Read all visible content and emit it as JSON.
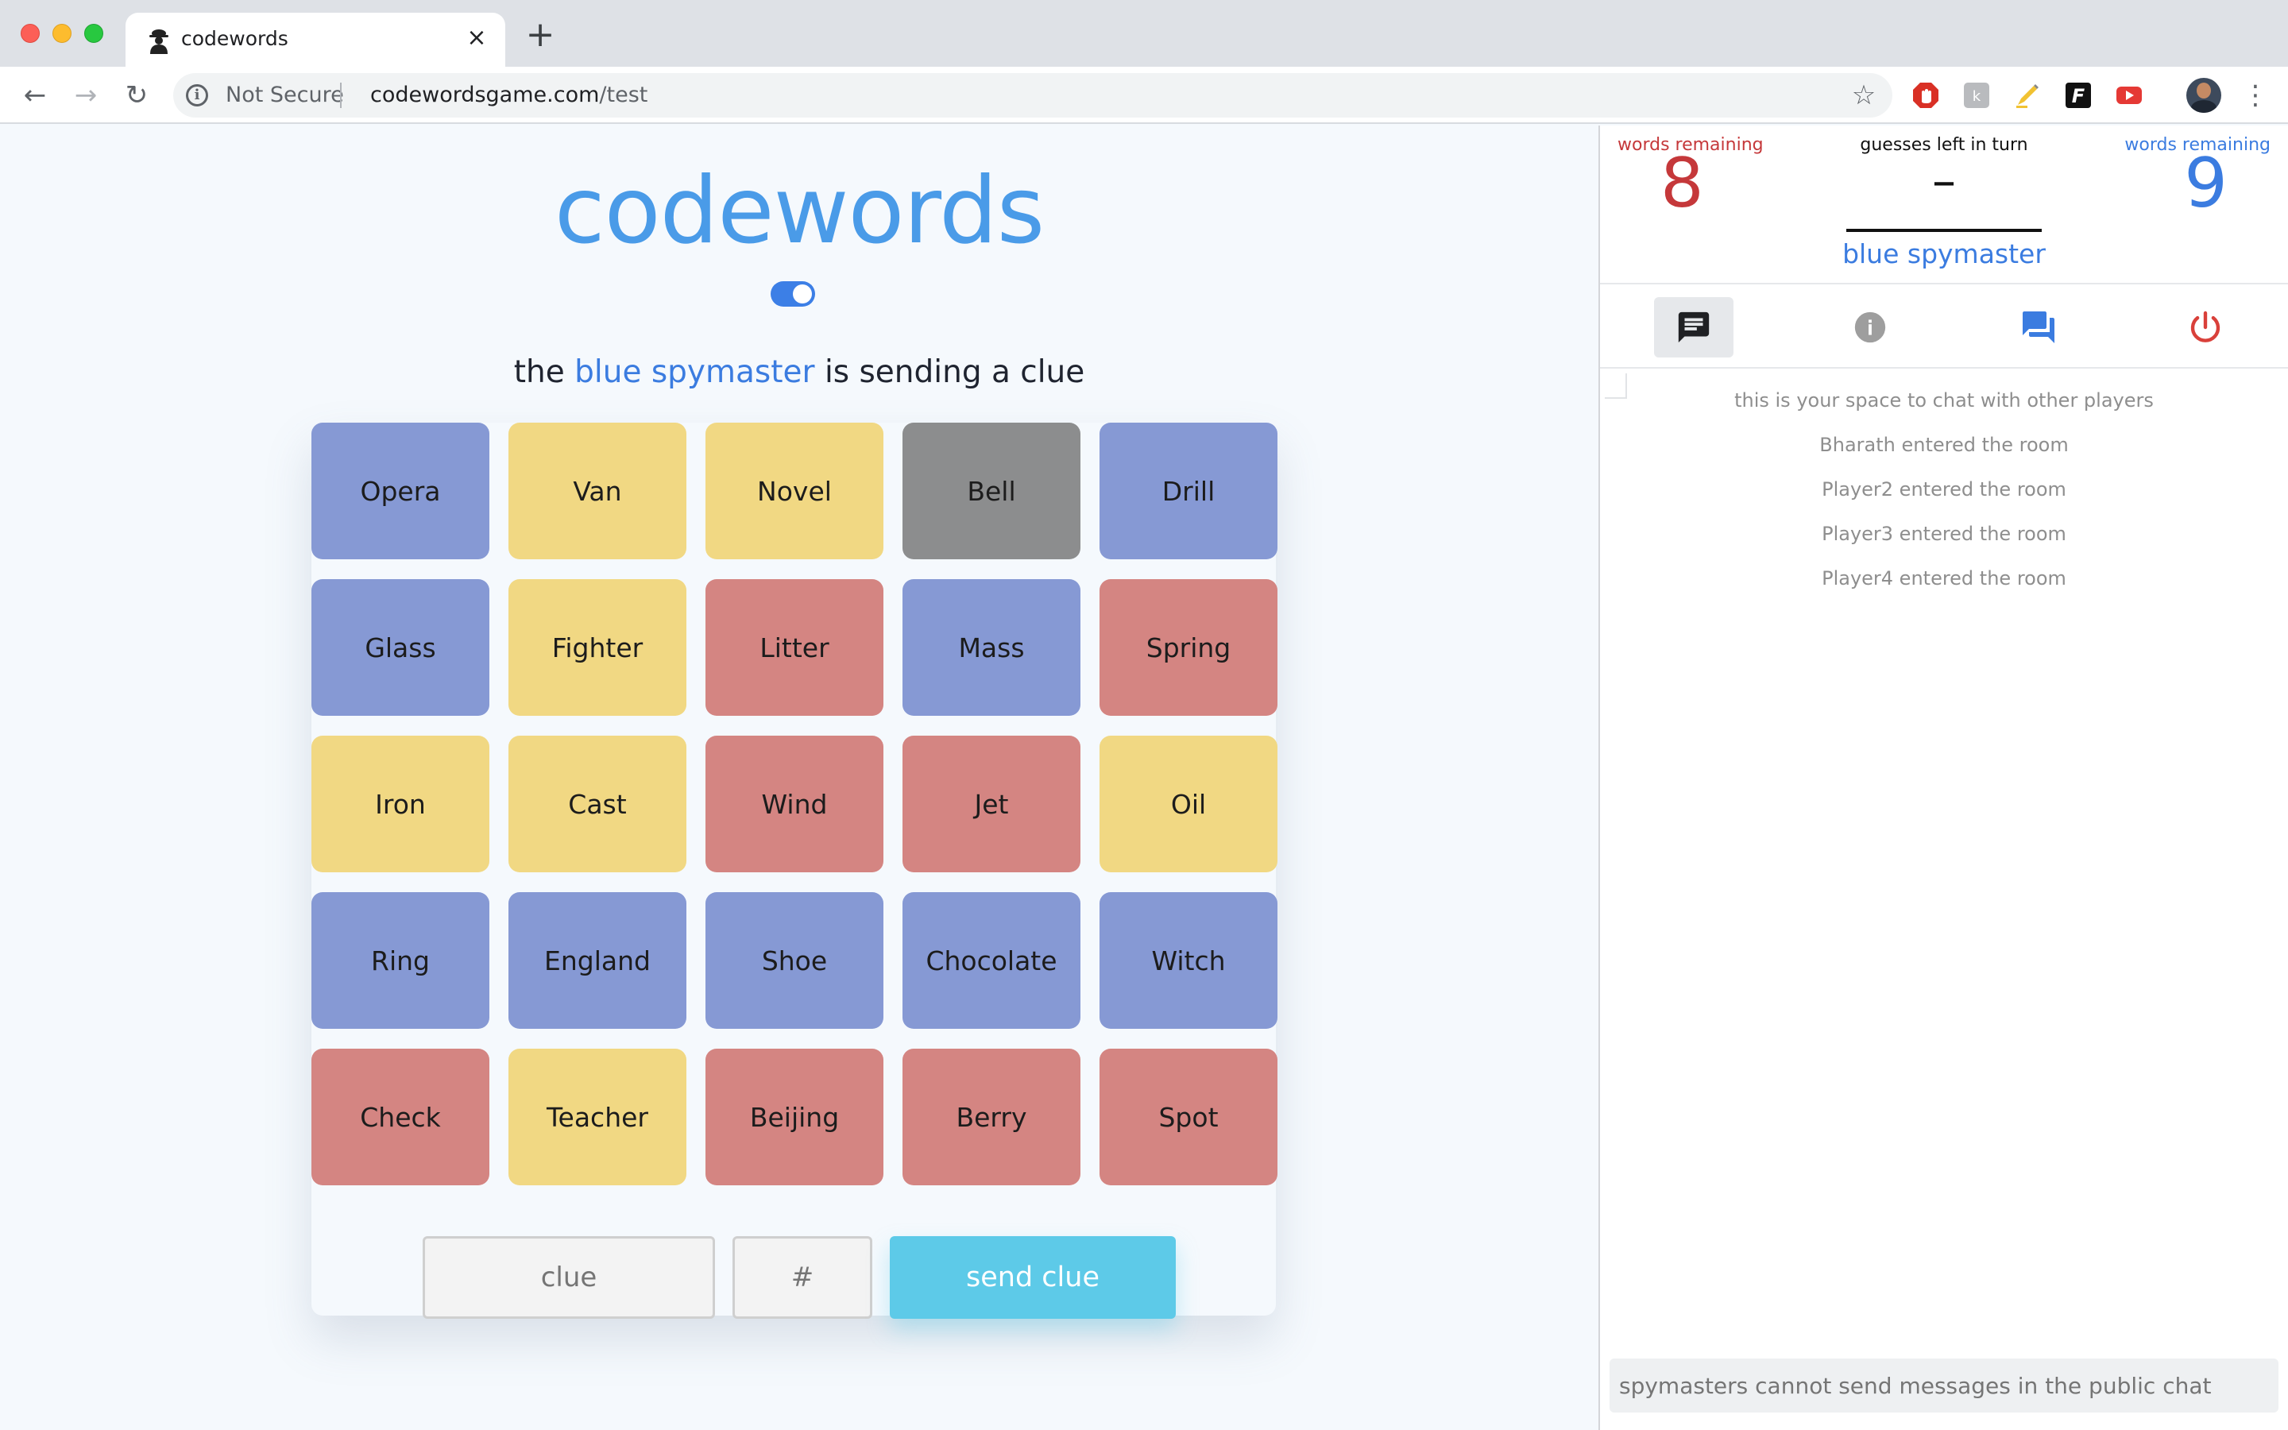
{
  "browser": {
    "tab_title": "codewords",
    "tab_close": "×",
    "new_tab": "+",
    "back": "←",
    "forward": "→",
    "reload": "↻",
    "security_label": "Not Secure",
    "url_host": "codewordsgame.com",
    "url_path": "/test",
    "bookmark_star": "☆",
    "menu": "⋮"
  },
  "game": {
    "logo": "codewords",
    "status_prefix": "the",
    "status_team": "blue spymaster",
    "status_suffix": "is sending a clue",
    "cards": [
      {
        "word": "Opera",
        "color": "blue"
      },
      {
        "word": "Van",
        "color": "yellow"
      },
      {
        "word": "Novel",
        "color": "yellow"
      },
      {
        "word": "Bell",
        "color": "gray"
      },
      {
        "word": "Drill",
        "color": "blue"
      },
      {
        "word": "Glass",
        "color": "blue"
      },
      {
        "word": "Fighter",
        "color": "yellow"
      },
      {
        "word": "Litter",
        "color": "red"
      },
      {
        "word": "Mass",
        "color": "blue"
      },
      {
        "word": "Spring",
        "color": "red"
      },
      {
        "word": "Iron",
        "color": "yellow"
      },
      {
        "word": "Cast",
        "color": "yellow"
      },
      {
        "word": "Wind",
        "color": "red"
      },
      {
        "word": "Jet",
        "color": "red"
      },
      {
        "word": "Oil",
        "color": "yellow"
      },
      {
        "word": "Ring",
        "color": "blue"
      },
      {
        "word": "England",
        "color": "blue"
      },
      {
        "word": "Shoe",
        "color": "blue"
      },
      {
        "word": "Chocolate",
        "color": "blue"
      },
      {
        "word": "Witch",
        "color": "blue"
      },
      {
        "word": "Check",
        "color": "red"
      },
      {
        "word": "Teacher",
        "color": "yellow"
      },
      {
        "word": "Beijing",
        "color": "red"
      },
      {
        "word": "Berry",
        "color": "red"
      },
      {
        "word": "Spot",
        "color": "red"
      }
    ],
    "clue_placeholder": "clue",
    "number_placeholder": "#",
    "send_label": "send clue"
  },
  "side": {
    "red_label": "words remaining",
    "red_count": "8",
    "guesses_label": "guesses left in turn",
    "guesses_value": "–",
    "blue_label": "words remaining",
    "blue_count": "9",
    "turn": "blue spymaster",
    "tabs": [
      {
        "icon": "chat-icon",
        "active": true
      },
      {
        "icon": "info-icon",
        "active": false
      },
      {
        "icon": "forum-icon",
        "active": false
      },
      {
        "icon": "power-icon",
        "active": false
      }
    ],
    "messages": [
      "this is your space to chat with other players",
      "Bharath entered the room",
      "Player2 entered the room",
      "Player3 entered the room",
      "Player4 entered the room"
    ],
    "chat_placeholder": "spymasters cannot send messages in the public chat"
  },
  "colors": {
    "blue_card": "#8699d4",
    "yellow_card": "#f1d883",
    "red_card": "#d48582",
    "gray_card": "#8c8d8e",
    "red_team": "#c5383a",
    "blue_team": "#3b7ce0",
    "send_button": "#5dcae8"
  }
}
